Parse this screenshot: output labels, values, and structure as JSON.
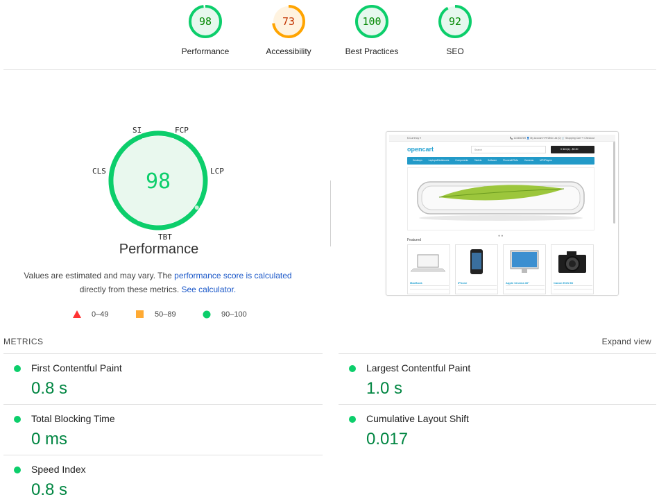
{
  "categories": [
    {
      "score": "98",
      "label": "Performance",
      "value": 0.98,
      "color": "#0cce6b",
      "text_color": "#008800",
      "bg": "#e6f8ee"
    },
    {
      "score": "73",
      "label": "Accessibility",
      "value": 0.73,
      "color": "#ffa400",
      "text_color": "#c33300",
      "bg": "#fff3e0"
    },
    {
      "score": "100",
      "label": "Best Practices",
      "value": 1.0,
      "color": "#0cce6b",
      "text_color": "#008800",
      "bg": "#e6f8ee"
    },
    {
      "score": "92",
      "label": "SEO",
      "value": 0.92,
      "color": "#0cce6b",
      "text_color": "#008800",
      "bg": "#e6f8ee"
    }
  ],
  "performance": {
    "score": "98",
    "title": "Performance",
    "axis_labels": {
      "si": "SI",
      "fcp": "FCP",
      "lcp": "LCP",
      "tbt": "TBT",
      "cls": "CLS"
    }
  },
  "note": {
    "prefix": "Values are estimated and may vary. The ",
    "link1": "performance score is calculated",
    "middle": "directly from these metrics. ",
    "link2": "See calculator."
  },
  "legend": [
    {
      "range": "0–49",
      "shape": "triangle",
      "color": "#ff3333"
    },
    {
      "range": "50–89",
      "shape": "square",
      "color": "#ffaa33"
    },
    {
      "range": "90–100",
      "shape": "circle",
      "color": "#0cce6b"
    }
  ],
  "thumbnail": {
    "currency": "$ Currency ▾",
    "top_links": "📞 123456789   👤 My Account ▾   ♥ Wish List (0)   🛒 Shopping Cart   ➜ Checkout",
    "logo": "opencart",
    "search_placeholder": "Search",
    "cart": "0 item(s) - $0.00",
    "nav": "Desktops Laptops&Notebooks Components Tablets Software Phones&PDAs Cameras MP3Players",
    "dots": "● ●",
    "featured": "Featured",
    "products": [
      "MacBook",
      "iPhone",
      "Apple Cinema 30\"",
      "Canon EOS 5D"
    ]
  },
  "metrics": {
    "heading": "METRICS",
    "expand_label": "Expand view",
    "items": [
      {
        "title": "First Contentful Paint",
        "value": "0.8 s"
      },
      {
        "title": "Largest Contentful Paint",
        "value": "1.0 s"
      },
      {
        "title": "Total Blocking Time",
        "value": "0 ms"
      },
      {
        "title": "Cumulative Layout Shift",
        "value": "0.017"
      },
      {
        "title": "Speed Index",
        "value": "0.8 s"
      }
    ]
  }
}
